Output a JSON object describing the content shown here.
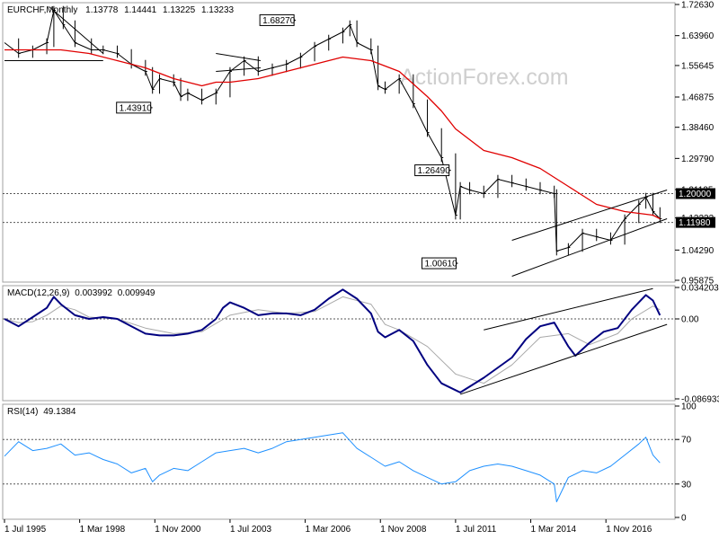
{
  "chart_data": {
    "type": "ohlc",
    "symbol": "EURCHF",
    "timeframe": "Monthly",
    "watermark": "ActionForex.com",
    "header_values": [
      "1.13778",
      "1.14441",
      "1.13225",
      "1.13233"
    ],
    "x_ticks": [
      "1 Jul 1995",
      "1 Mar 1998",
      "1 Nov 2000",
      "1 Jul 2003",
      "1 Mar 2006",
      "1 Nov 2008",
      "1 Jul 2011",
      "1 Mar 2014",
      "1 Nov 2016"
    ],
    "price": {
      "y_ticks": [
        "1.72630",
        "1.63960",
        "1.55645",
        "1.46875",
        "1.38460",
        "1.29790",
        "1.21125",
        "1.13233",
        "1.04290",
        "0.95875"
      ],
      "ylim": [
        0.95875,
        1.7263
      ],
      "levels": [
        {
          "label": "1.20000",
          "value": 1.2
        },
        {
          "label": "1.11980",
          "value": 1.1198
        }
      ],
      "current_label": "1.11980",
      "annotations": [
        {
          "text": "1.68270",
          "value": 1.6827,
          "date": "2005-11"
        },
        {
          "text": "1.43910",
          "value": 1.4391,
          "date": "2000-10"
        },
        {
          "text": "1.26490",
          "value": 1.2649,
          "date": "2011-05"
        },
        {
          "text": "1.00610",
          "value": 1.0061,
          "date": "2011-08"
        }
      ],
      "close_series": [
        [
          "1995-07",
          1.62
        ],
        [
          "1996-01",
          1.59
        ],
        [
          "1996-07",
          1.6
        ],
        [
          "1997-01",
          1.62
        ],
        [
          "1997-04",
          1.71
        ],
        [
          "1997-08",
          1.67
        ],
        [
          "1998-01",
          1.62
        ],
        [
          "1998-08",
          1.6
        ],
        [
          "1999-01",
          1.6
        ],
        [
          "1999-07",
          1.59
        ],
        [
          "2000-01",
          1.56
        ],
        [
          "2000-07",
          1.54
        ],
        [
          "2000-10",
          1.49
        ],
        [
          "2001-01",
          1.52
        ],
        [
          "2001-07",
          1.51
        ],
        [
          "2001-10",
          1.47
        ],
        [
          "2002-01",
          1.48
        ],
        [
          "2002-07",
          1.46
        ],
        [
          "2003-01",
          1.48
        ],
        [
          "2003-07",
          1.54
        ],
        [
          "2004-01",
          1.57
        ],
        [
          "2004-07",
          1.54
        ],
        [
          "2005-01",
          1.55
        ],
        [
          "2005-07",
          1.56
        ],
        [
          "2006-01",
          1.58
        ],
        [
          "2006-07",
          1.61
        ],
        [
          "2007-01",
          1.63
        ],
        [
          "2007-07",
          1.65
        ],
        [
          "2007-10",
          1.67
        ],
        [
          "2008-01",
          1.62
        ],
        [
          "2008-07",
          1.6
        ],
        [
          "2008-10",
          1.5
        ],
        [
          "2009-01",
          1.49
        ],
        [
          "2009-07",
          1.52
        ],
        [
          "2010-01",
          1.45
        ],
        [
          "2010-07",
          1.37
        ],
        [
          "2011-01",
          1.3
        ],
        [
          "2011-07",
          1.14
        ],
        [
          "2011-09",
          1.22
        ],
        [
          "2012-01",
          1.21
        ],
        [
          "2012-07",
          1.2
        ],
        [
          "2013-01",
          1.24
        ],
        [
          "2013-07",
          1.23
        ],
        [
          "2014-01",
          1.22
        ],
        [
          "2014-07",
          1.21
        ],
        [
          "2015-01",
          1.2
        ],
        [
          "2015-02",
          1.04
        ],
        [
          "2015-07",
          1.05
        ],
        [
          "2016-01",
          1.09
        ],
        [
          "2016-07",
          1.08
        ],
        [
          "2017-01",
          1.07
        ],
        [
          "2017-07",
          1.13
        ],
        [
          "2018-01",
          1.17
        ],
        [
          "2018-04",
          1.19
        ],
        [
          "2018-07",
          1.15
        ],
        [
          "2018-10",
          1.13
        ]
      ],
      "sma_series": [
        [
          "1995-07",
          1.6
        ],
        [
          "1996-07",
          1.6
        ],
        [
          "1997-07",
          1.6
        ],
        [
          "1998-07",
          1.59
        ],
        [
          "1999-07",
          1.57
        ],
        [
          "2000-07",
          1.55
        ],
        [
          "2001-07",
          1.52
        ],
        [
          "2002-07",
          1.5
        ],
        [
          "2003-01",
          1.51
        ],
        [
          "2003-07",
          1.51
        ],
        [
          "2004-07",
          1.52
        ],
        [
          "2005-07",
          1.54
        ],
        [
          "2006-07",
          1.56
        ],
        [
          "2007-07",
          1.58
        ],
        [
          "2008-07",
          1.57
        ],
        [
          "2009-07",
          1.54
        ],
        [
          "2010-07",
          1.47
        ],
        [
          "2011-01",
          1.43
        ],
        [
          "2011-07",
          1.38
        ],
        [
          "2012-07",
          1.32
        ],
        [
          "2013-07",
          1.3
        ],
        [
          "2014-07",
          1.27
        ],
        [
          "2015-07",
          1.22
        ],
        [
          "2016-07",
          1.17
        ],
        [
          "2017-07",
          1.15
        ],
        [
          "2018-07",
          1.14
        ],
        [
          "2018-10",
          1.13
        ]
      ],
      "trendlines": [
        {
          "from": [
            "1997-02",
            1.72
          ],
          "to": [
            "1999-01",
            1.59
          ]
        },
        {
          "from": [
            "1995-07",
            1.57
          ],
          "to": [
            "1999-01",
            1.57
          ]
        },
        {
          "from": [
            "2003-01",
            1.59
          ],
          "to": [
            "2004-08",
            1.57
          ]
        },
        {
          "from": [
            "2003-01",
            1.54
          ],
          "to": [
            "2004-08",
            1.55
          ]
        },
        {
          "from": [
            "2013-07",
            1.07
          ],
          "to": [
            "2019-01",
            1.21
          ]
        },
        {
          "from": [
            "2013-07",
            0.97
          ],
          "to": [
            "2019-01",
            1.13
          ]
        }
      ]
    },
    "macd": {
      "label": "MACD(12,26,9)",
      "macd_value": "0.003992",
      "signal_value": "0.009949",
      "y_ticks": [
        "0.034203",
        "0.00",
        "-0.086933"
      ],
      "ylim": [
        -0.086933,
        0.034203
      ],
      "macd_series": [
        [
          "1995-07",
          0.0
        ],
        [
          "1996-01",
          -0.008
        ],
        [
          "1996-07",
          0.002
        ],
        [
          "1997-01",
          0.012
        ],
        [
          "1997-04",
          0.024
        ],
        [
          "1997-07",
          0.016
        ],
        [
          "1998-01",
          0.004
        ],
        [
          "1998-07",
          0.0
        ],
        [
          "1999-01",
          0.002
        ],
        [
          "1999-07",
          0.0
        ],
        [
          "2000-01",
          -0.008
        ],
        [
          "2000-07",
          -0.016
        ],
        [
          "2001-01",
          -0.018
        ],
        [
          "2001-07",
          -0.018
        ],
        [
          "2002-01",
          -0.016
        ],
        [
          "2002-07",
          -0.012
        ],
        [
          "2003-01",
          0.0
        ],
        [
          "2003-04",
          0.012
        ],
        [
          "2003-07",
          0.018
        ],
        [
          "2004-01",
          0.012
        ],
        [
          "2004-07",
          0.004
        ],
        [
          "2005-01",
          0.006
        ],
        [
          "2005-07",
          0.006
        ],
        [
          "2006-01",
          0.004
        ],
        [
          "2006-07",
          0.01
        ],
        [
          "2007-01",
          0.022
        ],
        [
          "2007-07",
          0.032
        ],
        [
          "2008-01",
          0.022
        ],
        [
          "2008-07",
          0.006
        ],
        [
          "2008-10",
          -0.014
        ],
        [
          "2009-01",
          -0.02
        ],
        [
          "2009-07",
          -0.012
        ],
        [
          "2010-01",
          -0.024
        ],
        [
          "2010-07",
          -0.05
        ],
        [
          "2011-01",
          -0.07
        ],
        [
          "2011-09",
          -0.08
        ],
        [
          "2012-07",
          -0.064
        ],
        [
          "2013-07",
          -0.042
        ],
        [
          "2014-01",
          -0.022
        ],
        [
          "2014-07",
          -0.008
        ],
        [
          "2015-01",
          -0.004
        ],
        [
          "2015-07",
          -0.03
        ],
        [
          "2015-10",
          -0.04
        ],
        [
          "2016-04",
          -0.026
        ],
        [
          "2016-10",
          -0.014
        ],
        [
          "2017-04",
          -0.01
        ],
        [
          "2017-10",
          0.01
        ],
        [
          "2018-04",
          0.026
        ],
        [
          "2018-07",
          0.02
        ],
        [
          "2018-10",
          0.004
        ]
      ],
      "signal_series": [
        [
          "1995-07",
          0.0
        ],
        [
          "1996-01",
          -0.004
        ],
        [
          "1996-07",
          -0.003
        ],
        [
          "1997-01",
          0.004
        ],
        [
          "1997-07",
          0.014
        ],
        [
          "1998-01",
          0.01
        ],
        [
          "1998-07",
          0.002
        ],
        [
          "1999-07",
          0.0
        ],
        [
          "2000-07",
          -0.01
        ],
        [
          "2001-07",
          -0.016
        ],
        [
          "2002-07",
          -0.014
        ],
        [
          "2003-07",
          0.004
        ],
        [
          "2004-07",
          0.01
        ],
        [
          "2005-07",
          0.006
        ],
        [
          "2006-07",
          0.008
        ],
        [
          "2007-07",
          0.024
        ],
        [
          "2008-07",
          0.016
        ],
        [
          "2009-01",
          -0.006
        ],
        [
          "2009-07",
          -0.012
        ],
        [
          "2010-07",
          -0.03
        ],
        [
          "2011-07",
          -0.06
        ],
        [
          "2012-07",
          -0.07
        ],
        [
          "2013-07",
          -0.05
        ],
        [
          "2014-07",
          -0.02
        ],
        [
          "2015-07",
          -0.016
        ],
        [
          "2016-04",
          -0.028
        ],
        [
          "2017-04",
          -0.016
        ],
        [
          "2017-10",
          0.0
        ],
        [
          "2018-07",
          0.014
        ],
        [
          "2018-10",
          0.01
        ]
      ],
      "trendlines": [
        {
          "from": [
            "2011-09",
            -0.082
          ],
          "to": [
            "2019-01",
            -0.006
          ]
        },
        {
          "from": [
            "2012-07",
            -0.012
          ],
          "to": [
            "2018-07",
            0.033
          ]
        }
      ]
    },
    "rsi": {
      "label": "RSI(14)",
      "value": "49.1384",
      "y_ticks": [
        "100",
        "70",
        "30",
        "0"
      ],
      "ylim": [
        0,
        100
      ],
      "levels": [
        70,
        30
      ],
      "series": [
        [
          "1995-07",
          55
        ],
        [
          "1996-01",
          68
        ],
        [
          "1996-07",
          60
        ],
        [
          "1997-01",
          62
        ],
        [
          "1997-07",
          66
        ],
        [
          "1998-01",
          56
        ],
        [
          "1998-07",
          58
        ],
        [
          "1999-01",
          52
        ],
        [
          "1999-07",
          48
        ],
        [
          "2000-01",
          40
        ],
        [
          "2000-07",
          44
        ],
        [
          "2000-10",
          32
        ],
        [
          "2001-01",
          38
        ],
        [
          "2001-07",
          44
        ],
        [
          "2002-01",
          42
        ],
        [
          "2002-07",
          50
        ],
        [
          "2003-01",
          58
        ],
        [
          "2003-07",
          60
        ],
        [
          "2004-01",
          62
        ],
        [
          "2004-07",
          58
        ],
        [
          "2005-01",
          62
        ],
        [
          "2005-07",
          68
        ],
        [
          "2006-01",
          70
        ],
        [
          "2006-07",
          72
        ],
        [
          "2007-01",
          74
        ],
        [
          "2007-07",
          76
        ],
        [
          "2008-01",
          62
        ],
        [
          "2008-07",
          54
        ],
        [
          "2009-01",
          46
        ],
        [
          "2009-07",
          50
        ],
        [
          "2010-01",
          42
        ],
        [
          "2010-07",
          36
        ],
        [
          "2011-01",
          30
        ],
        [
          "2011-07",
          32
        ],
        [
          "2012-01",
          42
        ],
        [
          "2012-07",
          46
        ],
        [
          "2013-01",
          48
        ],
        [
          "2013-07",
          46
        ],
        [
          "2014-01",
          42
        ],
        [
          "2014-07",
          38
        ],
        [
          "2015-01",
          30
        ],
        [
          "2015-02",
          14
        ],
        [
          "2015-07",
          36
        ],
        [
          "2016-01",
          42
        ],
        [
          "2016-07",
          40
        ],
        [
          "2017-01",
          46
        ],
        [
          "2017-07",
          56
        ],
        [
          "2018-01",
          66
        ],
        [
          "2018-04",
          72
        ],
        [
          "2018-07",
          56
        ],
        [
          "2018-10",
          49
        ]
      ]
    }
  }
}
